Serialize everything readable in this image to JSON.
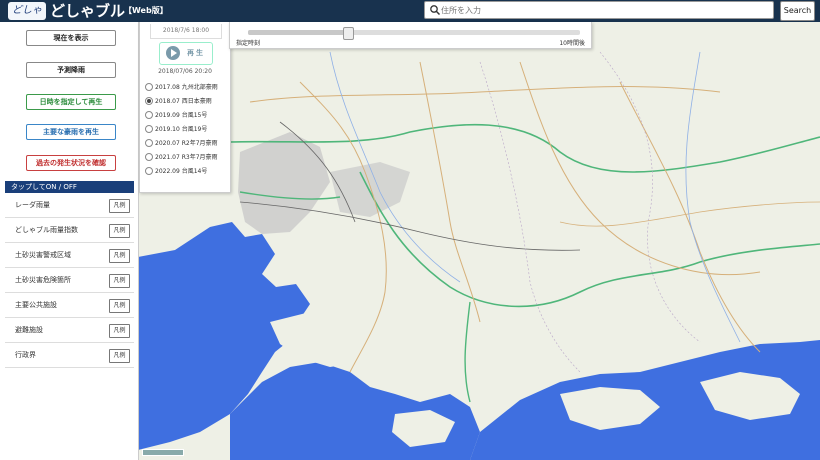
{
  "header": {
    "logo_text": "どしゃぶ",
    "app_title": "どしゃブル",
    "edition": "【Web版】",
    "search_placeholder": "住所を入力",
    "search_button": "Search"
  },
  "sidebar": {
    "buttons": [
      {
        "label": "現在を表示",
        "style": "default"
      },
      {
        "label": "予測降雨",
        "style": "default"
      },
      {
        "label": "日時を指定して再生",
        "style": "green"
      },
      {
        "label": "主要な豪雨を再生",
        "style": "blue"
      },
      {
        "label": "過去の発生状況を確認",
        "style": "red"
      }
    ],
    "layers_header": "タップしてON / OFF",
    "legend_label": "凡例",
    "layers": [
      "レーダ雨量",
      "どしゃブル雨量指数",
      "土砂災害警戒区域",
      "土砂災害危険箇所",
      "主要公共施設",
      "避難施設",
      "行政界"
    ]
  },
  "playback": {
    "current_time": "2018/7/6 18:00",
    "play_label": "再生",
    "date_display": "2018/07/06 20:20",
    "events": [
      {
        "label": "2017.08 九州北部豪雨",
        "selected": false
      },
      {
        "label": "2018.07 西日本豪雨",
        "selected": true
      },
      {
        "label": "2019.09 台風15号",
        "selected": false
      },
      {
        "label": "2019.10 台風19号",
        "selected": false
      },
      {
        "label": "2020.07 R2年7月豪雨",
        "selected": false
      },
      {
        "label": "2021.07 R3年7月豪雨",
        "selected": false
      },
      {
        "label": "2022.09 台風14号",
        "selected": false
      }
    ]
  },
  "time_slider": {
    "left_label": "指定時刻",
    "right_label": "10時間後",
    "value_fraction": 0.3
  },
  "colors": {
    "header_bg": "#18324e",
    "sea": "#3f6fe0",
    "land": "#eef0e6",
    "road_green": "#4fb67a",
    "road_tan": "#d6b07a"
  }
}
